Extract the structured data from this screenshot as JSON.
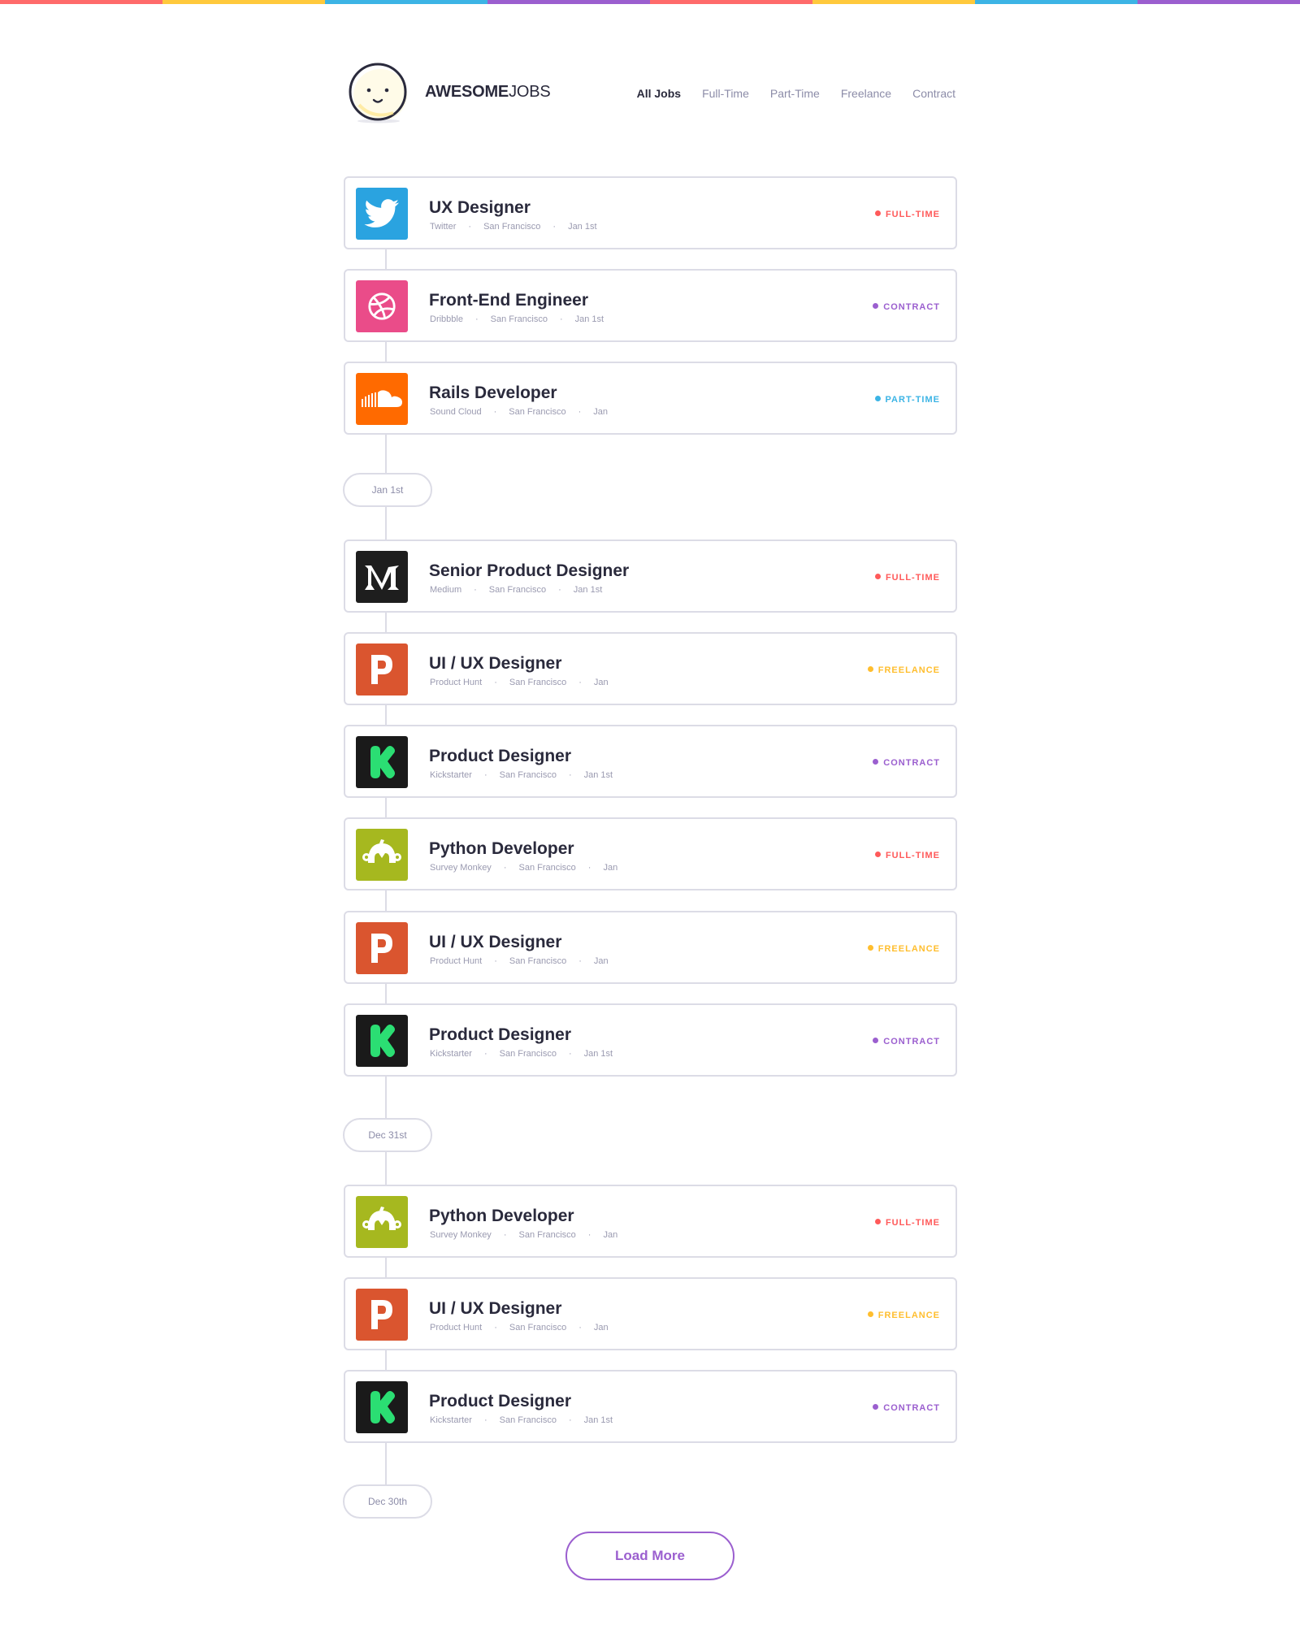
{
  "colors": {
    "rainbow": [
      "#ff6b6b",
      "#ffc93c",
      "#3cb4e5",
      "#9b5fcf",
      "#ff6b6b",
      "#ffc93c",
      "#3cb4e5",
      "#9b5fcf"
    ],
    "full_time": "#ff5a5a",
    "contract": "#9b5fcf",
    "part_time": "#3cb4e5",
    "freelance": "#ffbe2e"
  },
  "brand": {
    "bold": "AWESOME",
    "light": "JOBS"
  },
  "nav": [
    {
      "label": "All Jobs",
      "active": true
    },
    {
      "label": "Full-Time"
    },
    {
      "label": "Part-Time"
    },
    {
      "label": "Freelance"
    },
    {
      "label": "Contract"
    }
  ],
  "jobs": [
    {
      "title": "UX Designer",
      "company": "Twitter",
      "location": "San Francisco",
      "date": "Jan 1st",
      "type": "FULL-TIME",
      "logo": "twitter-icon"
    },
    {
      "title": "Front-End Engineer",
      "company": "Dribbble",
      "location": "San Francisco",
      "date": "Jan 1st",
      "type": "CONTRACT",
      "logo": "dribbble-icon"
    },
    {
      "title": "Rails Developer",
      "company": "Sound Cloud",
      "location": "San Francisco",
      "date": "Jan",
      "type": "PART-TIME",
      "logo": "soundcloud-icon"
    },
    {
      "title": "Senior Product Designer",
      "company": "Medium",
      "location": "San Francisco",
      "date": "Jan 1st",
      "type": "FULL-TIME",
      "logo": "medium-icon"
    },
    {
      "title": "UI / UX Designer",
      "company": "Product Hunt",
      "location": "San Francisco",
      "date": "Jan",
      "type": "FREELANCE",
      "logo": "producthunt-icon"
    },
    {
      "title": "Product Designer",
      "company": "Kickstarter",
      "location": "San Francisco",
      "date": "Jan 1st",
      "type": "CONTRACT",
      "logo": "kickstarter-icon"
    },
    {
      "title": "Python Developer",
      "company": "Survey Monkey",
      "location": "San Francisco",
      "date": "Jan",
      "type": "FULL-TIME",
      "logo": "surveymonkey-icon"
    },
    {
      "title": "UI / UX Designer",
      "company": "Product Hunt",
      "location": "San Francisco",
      "date": "Jan",
      "type": "FREELANCE",
      "logo": "producthunt-icon"
    },
    {
      "title": "Product Designer",
      "company": "Kickstarter",
      "location": "San Francisco",
      "date": "Jan 1st",
      "type": "CONTRACT",
      "logo": "kickstarter-icon"
    },
    {
      "title": "Python Developer",
      "company": "Survey Monkey",
      "location": "San Francisco",
      "date": "Jan",
      "type": "FULL-TIME",
      "logo": "surveymonkey-icon"
    },
    {
      "title": "UI / UX Designer",
      "company": "Product Hunt",
      "location": "San Francisco",
      "date": "Jan",
      "type": "FREELANCE",
      "logo": "producthunt-icon"
    },
    {
      "title": "Product Designer",
      "company": "Kickstarter",
      "location": "San Francisco",
      "date": "Jan 1st",
      "type": "CONTRACT",
      "logo": "kickstarter-icon"
    }
  ],
  "dates": [
    "Jan 1st",
    "Dec 31st",
    "Dec 30th"
  ],
  "load_more": "Load More"
}
